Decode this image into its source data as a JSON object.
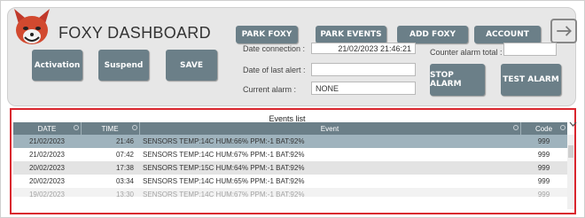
{
  "header": {
    "title": "FOXY DASHBOARD",
    "logo_icon": "fox-head-icon",
    "nav_buttons": [
      "PARK FOXY",
      "PARK EVENTS",
      "ADD FOXY",
      "ACCOUNT"
    ],
    "exit_icon": "exit-icon"
  },
  "controls": {
    "activation": "Activation",
    "suspend": "Suspend",
    "save": "SAVE",
    "stop_alarm": "STOP ALARM",
    "test_alarm": "TEST ALARM"
  },
  "info": {
    "date_connection_label": "Date connection :",
    "date_connection_value": "21/02/2023 21:46:21",
    "date_last_alert_label": "Date of last alert :",
    "date_last_alert_value": "",
    "current_alarm_label": "Current alarm :",
    "current_alarm_value": "NONE",
    "counter_alarm_label": "Counter alarm total :",
    "counter_alarm_value": ""
  },
  "events": {
    "title": "Events list",
    "columns": [
      "DATE",
      "TIME",
      "Event",
      "Code"
    ],
    "rows": [
      {
        "date": "21/02/2023",
        "time": "21:46",
        "event": "SENSORS TEMP:14C HUM:66% PPM:-1 BAT:92%",
        "code": "999"
      },
      {
        "date": "21/02/2023",
        "time": "07:42",
        "event": "SENSORS TEMP:14C HUM:67% PPM:-1 BAT:92%",
        "code": "999"
      },
      {
        "date": "20/02/2023",
        "time": "17:38",
        "event": "SENSORS TEMP:15C HUM:64% PPM:-1 BAT:92%",
        "code": "999"
      },
      {
        "date": "20/02/2023",
        "time": "03:34",
        "event": "SENSORS TEMP:14C HUM:65% PPM:-1 BAT:92%",
        "code": "999"
      },
      {
        "date": "19/02/2023",
        "time": "13:30",
        "event": "SENSORS TEMP:14C HUM:67% PPM:-1 BAT:92%",
        "code": "999"
      }
    ]
  },
  "colors": {
    "button_bg": "#6b7f88",
    "selected_row_bg": "#9fb3bd",
    "highlight_border": "#d9262e"
  }
}
